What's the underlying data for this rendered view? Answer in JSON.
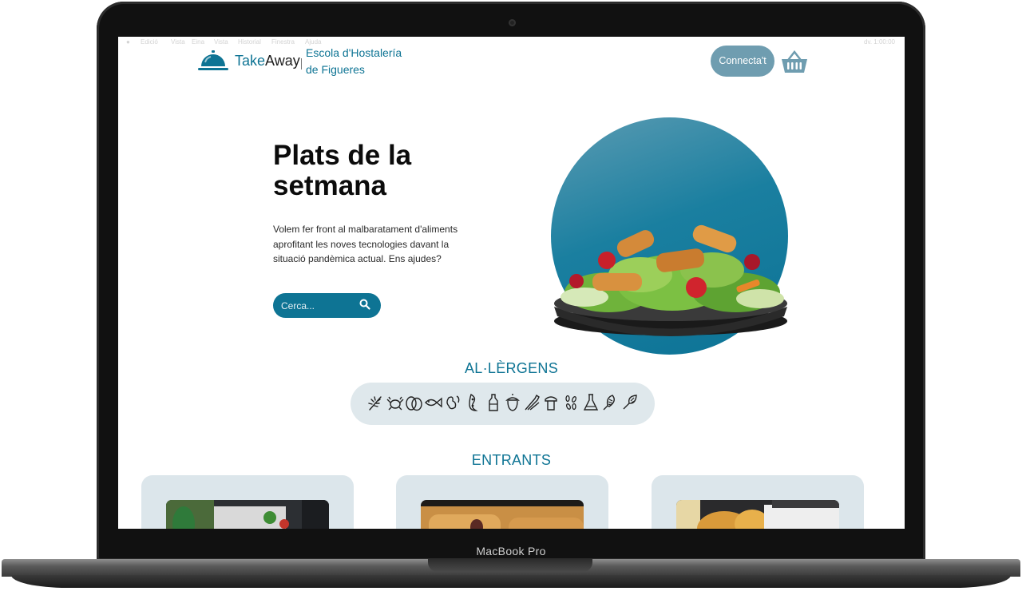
{
  "device": {
    "label": "MacBook Pro"
  },
  "menubar": {
    "items": [
      "Edició",
      "Vista",
      "Eina",
      "Vista",
      "Historial",
      "Finestra",
      "Ajuda"
    ],
    "right_text": "dv. 1:00:00"
  },
  "header": {
    "brand_part1": "Take",
    "brand_part2": "Away",
    "school_line1": "Escola d'Hostalería",
    "school_line2": "de Figueres",
    "connect_label": "Connecta't"
  },
  "hero": {
    "title": "Plats de la setmana",
    "text_line1": "Volem fer front al malbaratament d'aliments",
    "text_line2": "aprofitant les noves tecnologies davant la situació pandèmica actual. Ens ajudes?",
    "search_placeholder": "Cerca..."
  },
  "allergens": {
    "title": "AL·LÈRGENS",
    "icons": [
      "gluten-icon",
      "crustaceans-icon",
      "egg-icon",
      "fish-icon",
      "peanut-icon",
      "soy-icon",
      "milk-icon",
      "nuts-icon",
      "celery-icon",
      "mustard-icon",
      "sesame-icon",
      "sulphites-icon",
      "lupin-icon",
      "molluscs-icon"
    ]
  },
  "starters": {
    "title": "ENTRANTS"
  },
  "colors": {
    "primary": "#0e7494",
    "connect_bg": "#6f9db0",
    "allergens_bg": "#dfe8ec",
    "card_bg": "#dce6eb"
  }
}
